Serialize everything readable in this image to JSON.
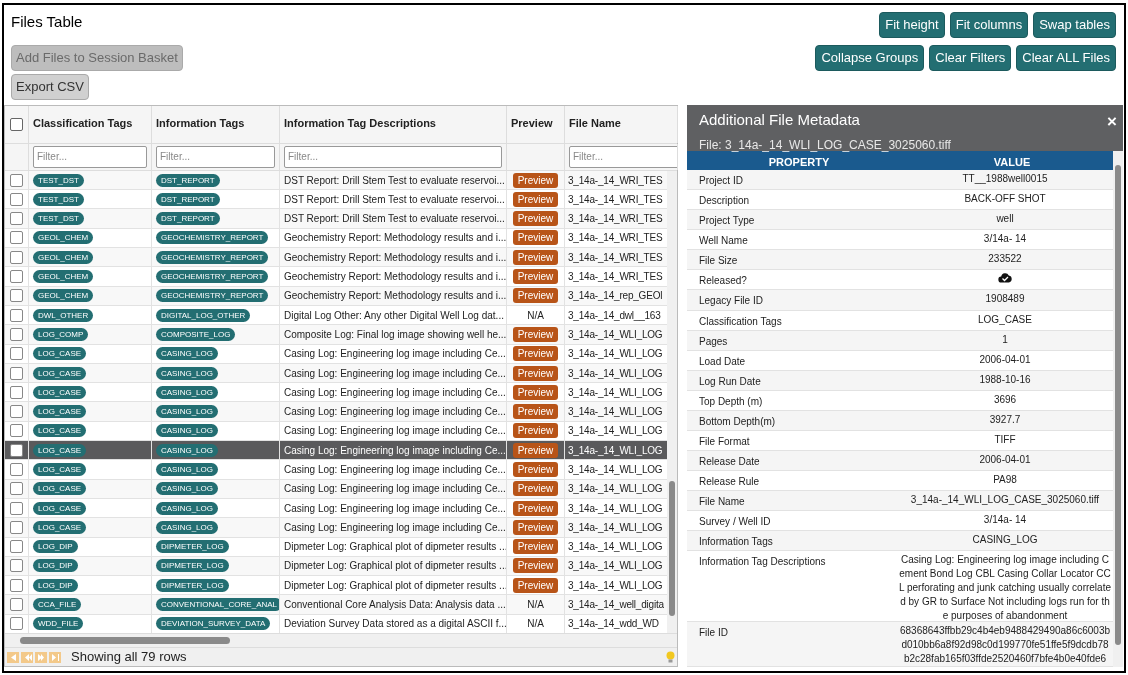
{
  "title": "Files Table",
  "left_buttons": [
    {
      "label": "Add Files to Session Basket",
      "disabled": true
    },
    {
      "label": "Export CSV",
      "disabled": false
    }
  ],
  "right_buttons": [
    [
      "Fit height",
      "Fit columns",
      "Swap tables"
    ],
    [
      "Collapse Groups",
      "Clear Filters",
      "Clear ALL Files"
    ]
  ],
  "table": {
    "select_all_checked": false,
    "columns": [
      {
        "label": "Classification Tags",
        "placeholder": "Filter..."
      },
      {
        "label": "Information Tags",
        "placeholder": "Filter..."
      },
      {
        "label": "Information Tag Descriptions",
        "placeholder": "Filter..."
      },
      {
        "label": "Preview"
      },
      {
        "label": "File Name",
        "placeholder": "Filter..."
      }
    ],
    "rows": [
      {
        "checked": false,
        "selected": false,
        "class_tag": "TEST_DST",
        "info_tag": "DST_REPORT",
        "description": "DST Report: Drill Stem Test to evaluate reservoi...",
        "preview": {
          "kind": "button",
          "label": "Preview"
        },
        "file_name": "3_14a-_14_WRI_TES"
      },
      {
        "checked": false,
        "selected": false,
        "class_tag": "TEST_DST",
        "info_tag": "DST_REPORT",
        "description": "DST Report: Drill Stem Test to evaluate reservoi...",
        "preview": {
          "kind": "button",
          "label": "Preview"
        },
        "file_name": "3_14a-_14_WRI_TES"
      },
      {
        "checked": false,
        "selected": false,
        "class_tag": "TEST_DST",
        "info_tag": "DST_REPORT",
        "description": "DST Report: Drill Stem Test to evaluate reservoi...",
        "preview": {
          "kind": "button",
          "label": "Preview"
        },
        "file_name": "3_14a-_14_WRI_TES"
      },
      {
        "checked": false,
        "selected": false,
        "class_tag": "GEOL_CHEM",
        "info_tag": "GEOCHEMISTRY_REPORT",
        "description": "Geochemistry Report: Methodology results and i...",
        "preview": {
          "kind": "button",
          "label": "Preview"
        },
        "file_name": "3_14a-_14_WRI_TES"
      },
      {
        "checked": false,
        "selected": false,
        "class_tag": "GEOL_CHEM",
        "info_tag": "GEOCHEMISTRY_REPORT",
        "description": "Geochemistry Report: Methodology results and i...",
        "preview": {
          "kind": "button",
          "label": "Preview"
        },
        "file_name": "3_14a-_14_WRI_TES"
      },
      {
        "checked": false,
        "selected": false,
        "class_tag": "GEOL_CHEM",
        "info_tag": "GEOCHEMISTRY_REPORT",
        "description": "Geochemistry Report: Methodology results and i...",
        "preview": {
          "kind": "button",
          "label": "Preview"
        },
        "file_name": "3_14a-_14_WRI_TES"
      },
      {
        "checked": false,
        "selected": false,
        "class_tag": "GEOL_CHEM",
        "info_tag": "GEOCHEMISTRY_REPORT",
        "description": "Geochemistry Report: Methodology results and i...",
        "preview": {
          "kind": "button",
          "label": "Preview"
        },
        "file_name": "3_14a-_14_rep_GEOl"
      },
      {
        "checked": false,
        "selected": false,
        "class_tag": "DWL_OTHER",
        "info_tag": "DIGITAL_LOG_OTHER",
        "description": "Digital Log Other: Any other Digital Well Log dat...",
        "preview": {
          "kind": "na",
          "label": "N/A"
        },
        "file_name": "3_14a-_14_dwl__163"
      },
      {
        "checked": false,
        "selected": false,
        "class_tag": "LOG_COMP",
        "info_tag": "COMPOSITE_LOG",
        "description": "Composite Log: Final log image showing well he...",
        "preview": {
          "kind": "button",
          "label": "Preview"
        },
        "file_name": "3_14a-_14_WLI_LOG"
      },
      {
        "checked": false,
        "selected": false,
        "class_tag": "LOG_CASE",
        "info_tag": "CASING_LOG",
        "description": "Casing Log: Engineering log image including Ce...",
        "preview": {
          "kind": "button",
          "label": "Preview"
        },
        "file_name": "3_14a-_14_WLI_LOG"
      },
      {
        "checked": false,
        "selected": false,
        "class_tag": "LOG_CASE",
        "info_tag": "CASING_LOG",
        "description": "Casing Log: Engineering log image including Ce...",
        "preview": {
          "kind": "button",
          "label": "Preview"
        },
        "file_name": "3_14a-_14_WLI_LOG"
      },
      {
        "checked": false,
        "selected": false,
        "class_tag": "LOG_CASE",
        "info_tag": "CASING_LOG",
        "description": "Casing Log: Engineering log image including Ce...",
        "preview": {
          "kind": "button",
          "label": "Preview"
        },
        "file_name": "3_14a-_14_WLI_LOG"
      },
      {
        "checked": false,
        "selected": false,
        "class_tag": "LOG_CASE",
        "info_tag": "CASING_LOG",
        "description": "Casing Log: Engineering log image including Ce...",
        "preview": {
          "kind": "button",
          "label": "Preview"
        },
        "file_name": "3_14a-_14_WLI_LOG"
      },
      {
        "checked": false,
        "selected": false,
        "class_tag": "LOG_CASE",
        "info_tag": "CASING_LOG",
        "description": "Casing Log: Engineering log image including Ce...",
        "preview": {
          "kind": "button",
          "label": "Preview"
        },
        "file_name": "3_14a-_14_WLI_LOG"
      },
      {
        "checked": false,
        "selected": true,
        "class_tag": "LOG_CASE",
        "info_tag": "CASING_LOG",
        "description": "Casing Log: Engineering log image including Ce...",
        "preview": {
          "kind": "button",
          "label": "Preview"
        },
        "file_name": "3_14a-_14_WLI_LOG"
      },
      {
        "checked": false,
        "selected": false,
        "class_tag": "LOG_CASE",
        "info_tag": "CASING_LOG",
        "description": "Casing Log: Engineering log image including Ce...",
        "preview": {
          "kind": "button",
          "label": "Preview"
        },
        "file_name": "3_14a-_14_WLI_LOG"
      },
      {
        "checked": false,
        "selected": false,
        "class_tag": "LOG_CASE",
        "info_tag": "CASING_LOG",
        "description": "Casing Log: Engineering log image including Ce...",
        "preview": {
          "kind": "button",
          "label": "Preview"
        },
        "file_name": "3_14a-_14_WLI_LOG"
      },
      {
        "checked": false,
        "selected": false,
        "class_tag": "LOG_CASE",
        "info_tag": "CASING_LOG",
        "description": "Casing Log: Engineering log image including Ce...",
        "preview": {
          "kind": "button",
          "label": "Preview"
        },
        "file_name": "3_14a-_14_WLI_LOG"
      },
      {
        "checked": false,
        "selected": false,
        "class_tag": "LOG_CASE",
        "info_tag": "CASING_LOG",
        "description": "Casing Log: Engineering log image including Ce...",
        "preview": {
          "kind": "button",
          "label": "Preview"
        },
        "file_name": "3_14a-_14_WLI_LOG"
      },
      {
        "checked": false,
        "selected": false,
        "class_tag": "LOG_DIP",
        "info_tag": "DIPMETER_LOG",
        "description": "Dipmeter Log: Graphical plot of dipmeter results ...",
        "preview": {
          "kind": "button",
          "label": "Preview"
        },
        "file_name": "3_14a-_14_WLI_LOG"
      },
      {
        "checked": false,
        "selected": false,
        "class_tag": "LOG_DIP",
        "info_tag": "DIPMETER_LOG",
        "description": "Dipmeter Log: Graphical plot of dipmeter results ...",
        "preview": {
          "kind": "button",
          "label": "Preview"
        },
        "file_name": "3_14a-_14_WLI_LOG"
      },
      {
        "checked": false,
        "selected": false,
        "class_tag": "LOG_DIP",
        "info_tag": "DIPMETER_LOG",
        "description": "Dipmeter Log: Graphical plot of dipmeter results ...",
        "preview": {
          "kind": "button",
          "label": "Preview"
        },
        "file_name": "3_14a-_14_WLI_LOG"
      },
      {
        "checked": false,
        "selected": false,
        "class_tag": "CCA_FILE",
        "info_tag": "CONVENTIONAL_CORE_ANAL",
        "description": "Conventional Core Analysis Data: Analysis data ...",
        "preview": {
          "kind": "na",
          "label": "N/A"
        },
        "file_name": "3_14a-_14_well_digita"
      },
      {
        "checked": false,
        "selected": false,
        "class_tag": "WDD_FILE",
        "info_tag": "DEVIATION_SURVEY_DATA",
        "description": "Deviation Survey Data stored as a digital ASCII f...",
        "preview": {
          "kind": "na",
          "label": "N/A"
        },
        "file_name": "3_14a-_14_wdd_WD"
      }
    ],
    "status": "Showing all 79 rows"
  },
  "metadata_panel": {
    "title": "Additional File Metadata",
    "close": "×",
    "file": "File: 3_14a-_14_WLI_LOG_CASE_3025060.tiff",
    "columns": [
      "PROPERTY",
      "VALUE"
    ],
    "rows": [
      {
        "property": "Project ID",
        "value": "TT__1988well0015"
      },
      {
        "property": "Description",
        "value": "BACK-OFF SHOT"
      },
      {
        "property": "Project Type",
        "value": "well"
      },
      {
        "property": "Well Name",
        "value": "3/14a- 14"
      },
      {
        "property": "File Size",
        "value": "233522"
      },
      {
        "property": "Released?",
        "kind": "icon"
      },
      {
        "property": "Legacy File ID",
        "value": "1908489"
      },
      {
        "property": "Classification Tags",
        "value": "LOG_CASE"
      },
      {
        "property": "Pages",
        "value": "1"
      },
      {
        "property": "Load Date",
        "value": "2006-04-01"
      },
      {
        "property": "Log Run Date",
        "value": "1988-10-16"
      },
      {
        "property": "Top Depth (m)",
        "value": "3696"
      },
      {
        "property": "Bottom Depth(m)",
        "value": "3927.7"
      },
      {
        "property": "File Format",
        "value": "TIFF"
      },
      {
        "property": "Release Date",
        "value": "2006-04-01"
      },
      {
        "property": "Release Rule",
        "value": "PA98"
      },
      {
        "property": "File Name",
        "value": "3_14a-_14_WLI_LOG_CASE_3025060.tiff"
      },
      {
        "property": "Survey / Well ID",
        "value": "3/14a- 14"
      },
      {
        "property": "Information Tags",
        "value": "CASING_LOG"
      },
      {
        "property": "Information Tag Descriptions",
        "value": "Casing Log: Engineering log image including Cement Bond Log CBL Casing Collar Locator CCL perforating and junk catching usually correlated by GR to Surface Not including logs run for the purposes of abandonment"
      },
      {
        "property": "File ID",
        "value": "68368643ffbb29c4b4eb9488429490a86c6003bd010bb6a8f92d98c0d199770fe51ffe5f9dcdb78b2c28fab165f03ffde2520460f7bfe4b0e40fde6"
      }
    ]
  }
}
